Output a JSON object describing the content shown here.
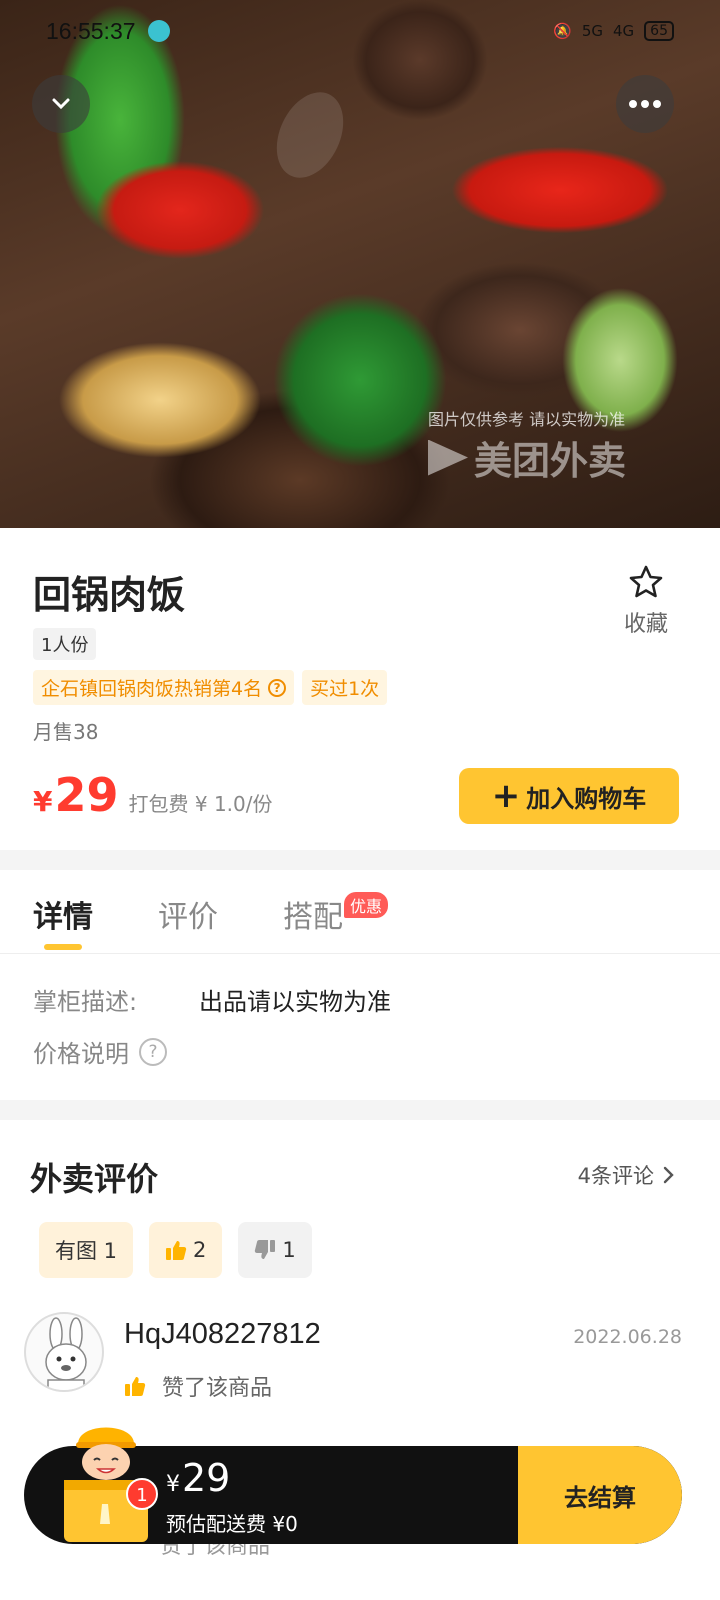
{
  "status_bar": {
    "time": "16:55:37",
    "network": "5G",
    "signal": "4G",
    "battery": "65"
  },
  "watermark": {
    "note": "图片仅供参考 请以实物为准",
    "logo": "美团外卖"
  },
  "product": {
    "name": "回锅肉饭",
    "portion": "1人份",
    "tags": [
      "企石镇回锅肉饭热销第4名",
      "买过1次"
    ],
    "monthly_sales": "月售38",
    "currency": "¥",
    "price": "29",
    "packing_fee": "打包费 ¥ 1.0/份",
    "favorite_label": "收藏",
    "add_to_cart_label": "加入购物车"
  },
  "tabs": [
    {
      "label": "详情",
      "active": true
    },
    {
      "label": "评价",
      "active": false
    },
    {
      "label": "搭配",
      "active": false,
      "badge": "优惠"
    }
  ],
  "details": {
    "seller_desc_label": "掌柜描述:",
    "seller_desc_value": "出品请以实物为准",
    "price_note_label": "价格说明",
    "price_note_icon": "?"
  },
  "reviews": {
    "title": "外卖评价",
    "count_label": "4条评论",
    "filters": [
      {
        "label": "有图 1"
      },
      {
        "count": "2",
        "icon": "thumbs-up"
      },
      {
        "count": "1",
        "icon": "thumbs-down"
      }
    ],
    "items": [
      {
        "user": "HqJ408227812",
        "date": "2022.06.28",
        "text": "赞了该商品"
      },
      {
        "text": "赞了该商品"
      }
    ]
  },
  "cart": {
    "currency": "¥",
    "total": "29",
    "delivery_fee": "预估配送费 ¥0",
    "checkout_label": "去结算",
    "item_count": "1"
  },
  "colors": {
    "accent": "#ffc531",
    "price": "#ff3b2f",
    "tag_text": "#f08d00",
    "tag_bg": "#fff5e0"
  }
}
